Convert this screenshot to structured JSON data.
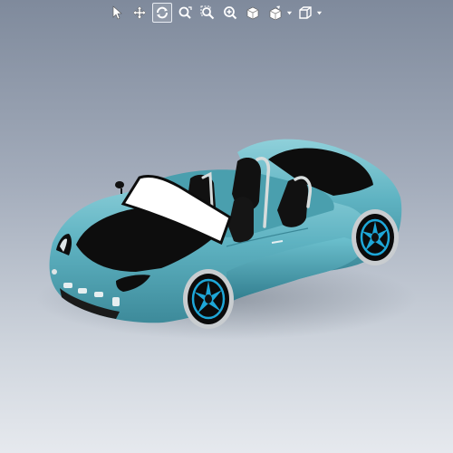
{
  "toolbar": {
    "tools": [
      {
        "name": "select-arrow-icon",
        "active": false
      },
      {
        "name": "pan-move-icon",
        "active": false
      },
      {
        "name": "rotate-icon",
        "active": true
      },
      {
        "name": "zoom-fit-icon",
        "active": false
      },
      {
        "name": "zoom-area-icon",
        "active": false
      },
      {
        "name": "zoom-in-out-icon",
        "active": false
      },
      {
        "name": "shaded-view-icon",
        "active": false
      },
      {
        "name": "display-style-icon",
        "active": false,
        "dropdown": true
      },
      {
        "name": "view-orientation-icon",
        "active": false,
        "dropdown": true
      }
    ]
  },
  "colors": {
    "background_top": "#7f8a9c",
    "background_bottom": "#e6e9ee",
    "toolbar_icon": "#ffffff",
    "car_body": "#5fb3c2",
    "car_body_dark": "#3d8a9a",
    "car_body_light": "#8fd0da",
    "panels": "#0d0d0d",
    "windshield": "#ffffff",
    "wheel_rim_accent": "#1ea7d8",
    "tire": "#c9cdd0"
  },
  "model": {
    "subject": "convertible-sports-car"
  }
}
